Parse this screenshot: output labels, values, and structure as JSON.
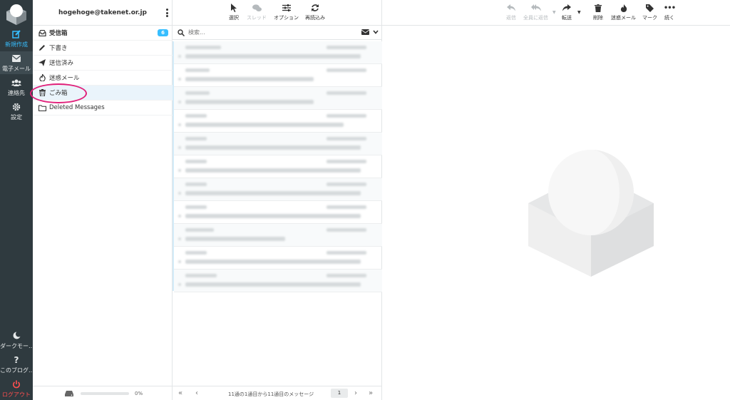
{
  "nav": {
    "compose": "新規作成",
    "mail": "電子メール",
    "contacts": "連絡先",
    "settings": "設定",
    "dark_mode": "ダークモー…",
    "about": "このブログ…",
    "logout": "ログアウト"
  },
  "account": {
    "email": "hogehoge@takenet.or.jp"
  },
  "folders": [
    {
      "label": "受信箱",
      "icon": "inbox-icon",
      "unread": "6"
    },
    {
      "label": "下書き",
      "icon": "pencil-icon"
    },
    {
      "label": "送信済み",
      "icon": "paper-plane-icon"
    },
    {
      "label": "迷惑メール",
      "icon": "fire-icon"
    },
    {
      "label": "ごみ箱",
      "icon": "trash-icon"
    },
    {
      "label": "Deleted Messages",
      "icon": "folder-icon"
    }
  ],
  "quota": {
    "percent": "0%"
  },
  "list_toolbar": {
    "select": "選択",
    "threads": "スレッド",
    "options": "オプション",
    "refresh": "再読込み"
  },
  "search": {
    "placeholder": "検索..."
  },
  "pagination": {
    "info": "11通の1通目から11通目のメッセージ",
    "page": "1"
  },
  "message_toolbar": {
    "reply": "返信",
    "reply_all": "全員に返信",
    "forward": "転送",
    "delete": "削除",
    "spam": "迷惑メール",
    "mark": "マーク",
    "more": "続く"
  },
  "colors": {
    "nav_bg": "#2f3a3f",
    "accent": "#37beff",
    "logout": "#ff4f4f",
    "highlight_circle": "#e0207a"
  }
}
